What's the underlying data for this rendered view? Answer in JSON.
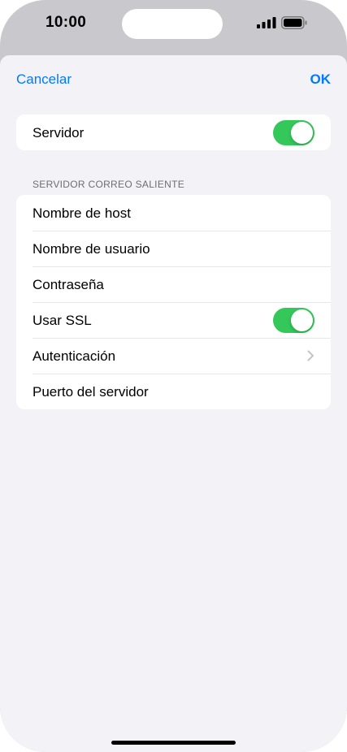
{
  "status_bar": {
    "time": "10:00"
  },
  "nav": {
    "cancel_label": "Cancelar",
    "ok_label": "OK"
  },
  "server_group": {
    "label": "Servidor",
    "enabled": true
  },
  "outgoing": {
    "section_title": "SERVIDOR CORREO SALIENTE",
    "host_label": "Nombre de host",
    "username_label": "Nombre de usuario",
    "password_label": "Contraseña",
    "ssl_label": "Usar SSL",
    "ssl_enabled": true,
    "auth_label": "Autenticación",
    "port_label": "Puerto del servidor"
  },
  "colors": {
    "accent": "#007aff",
    "toggle_on": "#34c759",
    "background": "#f2f2f7"
  },
  "icons": {
    "signal": "cellular-signal-icon",
    "battery": "battery-icon",
    "chevron": "chevron-right-icon"
  }
}
